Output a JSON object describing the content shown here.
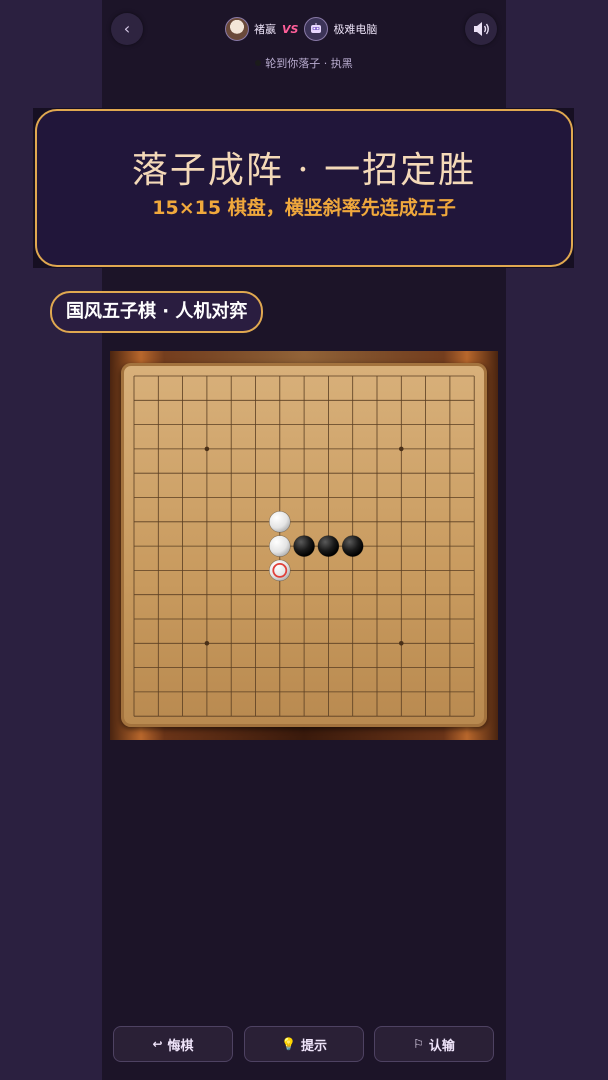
{
  "header": {
    "back_icon": "‹",
    "player_name": "褚嬴",
    "vs_label": "VS",
    "opponent_name": "极难电脑",
    "turn_text": "轮到你落子 · 执黑"
  },
  "banner": {
    "title": "落子成阵 · 一招定胜",
    "subtitle": "15×15 棋盘，横竖斜率先连成五子"
  },
  "mode_tag": "国风五子棋 · 人机对弈",
  "board": {
    "size": 15,
    "star_points": [
      [
        3,
        3
      ],
      [
        3,
        11
      ],
      [
        11,
        3
      ],
      [
        11,
        11
      ]
    ],
    "stones": [
      {
        "row": 6,
        "col": 6,
        "color": "white"
      },
      {
        "row": 7,
        "col": 6,
        "color": "white"
      },
      {
        "row": 7,
        "col": 7,
        "color": "black"
      },
      {
        "row": 7,
        "col": 8,
        "color": "black"
      },
      {
        "row": 7,
        "col": 9,
        "color": "black"
      }
    ],
    "last_move": {
      "row": 8,
      "col": 6,
      "color": "white"
    }
  },
  "buttons": {
    "undo": {
      "icon": "↩",
      "label": "悔棋"
    },
    "hint": {
      "icon": "💡",
      "label": "提示"
    },
    "resign": {
      "icon": "⚐",
      "label": "认输"
    }
  },
  "colors": {
    "accent": "#e0a850",
    "subtitle": "#f0a83c",
    "vs": "#ff5f9a",
    "last_move_ring": "#e0403a"
  }
}
